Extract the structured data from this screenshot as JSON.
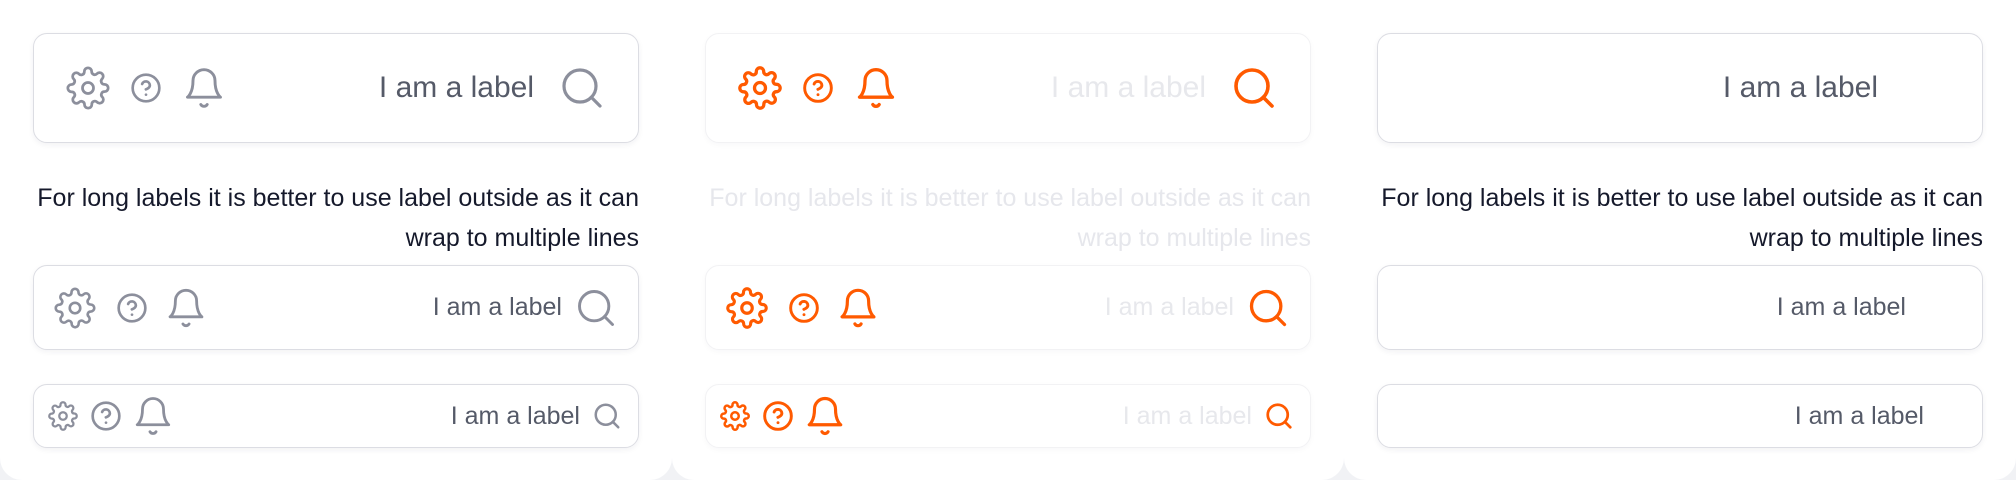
{
  "field_label": "I am a label",
  "long_label": "For long labels it is better to use label outside as it can wrap to multiple lines",
  "icons": [
    "gear-icon",
    "help-circle-icon",
    "bell-icon",
    "search-icon"
  ],
  "colors": {
    "icon_default": "#8c8f9c",
    "icon_accent": "#ff5a00",
    "label_text": "#555a68",
    "disabled_text": "#e7e8ec",
    "outside_label_text": "#15192b",
    "border": "#dcdde3"
  }
}
